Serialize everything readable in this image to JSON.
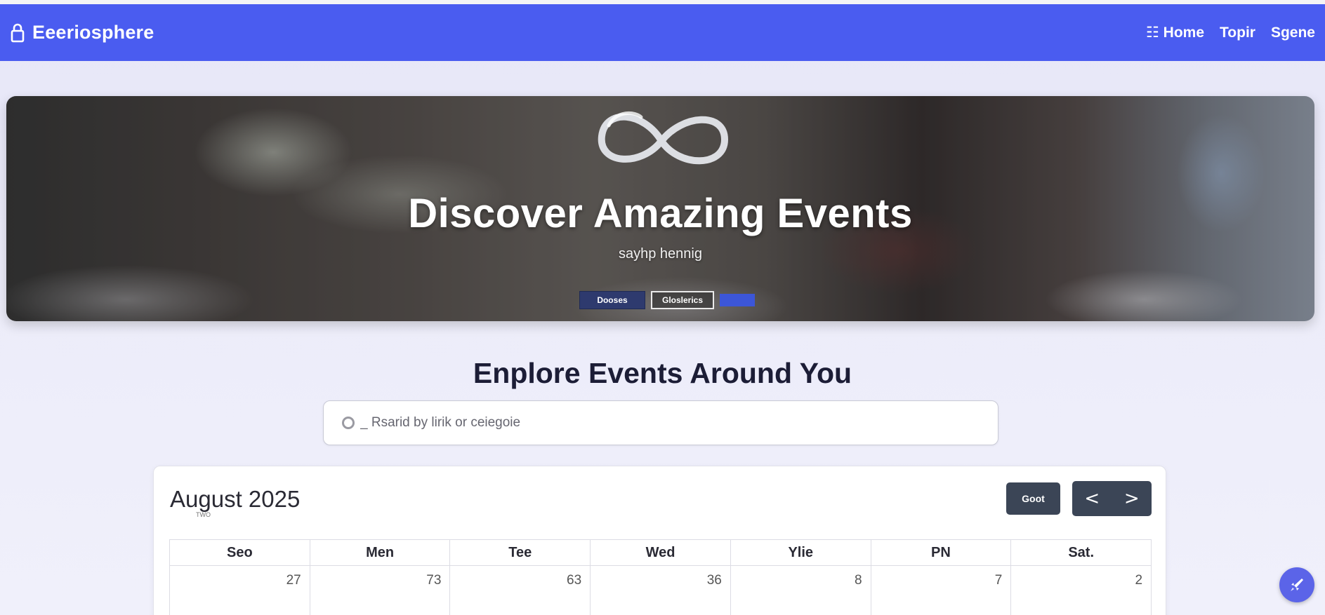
{
  "app": {
    "brand_name": "Eeeriosphere",
    "accent_color": "#4a5cf0"
  },
  "nav": {
    "links": [
      {
        "label": "Home",
        "prefix": "☷",
        "icon": "grid-icon"
      },
      {
        "label": "Topir"
      },
      {
        "label": "Sgene"
      }
    ]
  },
  "hero": {
    "title": "Discover Amazing Events",
    "subtitle": "sayhp hennig",
    "primary_button": "Dooses",
    "secondary_button": "Gloslerics"
  },
  "explore": {
    "title": "Enplore Events Around You",
    "search_placeholder": "_ Rsarid by lirik or ceiegoie"
  },
  "calendar": {
    "month_label": "August 2025",
    "month_note": "TWO",
    "today_button": "Goot",
    "prev_button": "<",
    "next_button": ">",
    "weekdays": [
      "Seo",
      "Men",
      "Tee",
      "Wed",
      "Ylie",
      "PN",
      "Sat."
    ],
    "first_row_days": [
      "27",
      "73",
      "63",
      "36",
      "8",
      "7",
      "2"
    ]
  }
}
